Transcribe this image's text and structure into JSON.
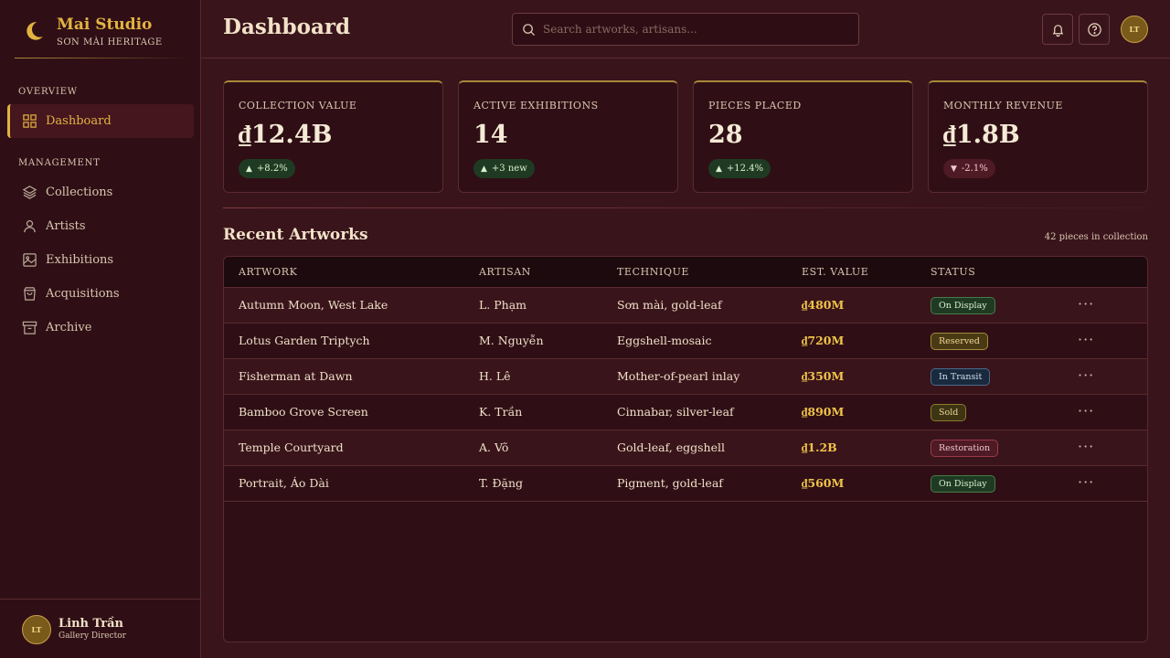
{
  "brand": {
    "title": "Mai Studio",
    "subtitle": "SƠN MÀI HERITAGE"
  },
  "sidebar": {
    "overview_label": "OVERVIEW",
    "management_label": "MANAGEMENT",
    "items": [
      {
        "label": "Dashboard",
        "icon": "grid-icon",
        "active": true
      },
      {
        "label": "Collections",
        "icon": "layers-icon"
      },
      {
        "label": "Artists",
        "icon": "user-icon"
      },
      {
        "label": "Exhibitions",
        "icon": "image-icon"
      },
      {
        "label": "Acquisitions",
        "icon": "bag-icon"
      },
      {
        "label": "Archive",
        "icon": "archive-icon"
      }
    ],
    "user": {
      "initials": "LT",
      "name": "Linh Trần",
      "role": "Gallery Director"
    }
  },
  "header": {
    "title": "Dashboard",
    "search_placeholder": "Search artworks, artisans...",
    "avatar_initials": "LT"
  },
  "stats": [
    {
      "label": "COLLECTION VALUE",
      "value": "₫12.4B",
      "change": "+8.2%",
      "trend": "up"
    },
    {
      "label": "ACTIVE EXHIBITIONS",
      "value": "14",
      "change": "+3 new",
      "trend": "up"
    },
    {
      "label": "PIECES PLACED",
      "value": "28",
      "change": "+12.4%",
      "trend": "up"
    },
    {
      "label": "MONTHLY REVENUE",
      "value": "₫1.8B",
      "change": "-2.1%",
      "trend": "down"
    }
  ],
  "recent": {
    "title": "Recent Artworks",
    "count_text": "42 pieces in collection",
    "columns": [
      "ARTWORK",
      "ARTISAN",
      "TECHNIQUE",
      "EST. VALUE",
      "STATUS"
    ],
    "rows": [
      {
        "artwork": "Autumn Moon, West Lake",
        "artisan": "L. Phạm",
        "technique": "Sơn mài, gold-leaf",
        "value": "₫480M",
        "status": "On Display"
      },
      {
        "artwork": "Lotus Garden Triptych",
        "artisan": "M. Nguyễn",
        "technique": "Eggshell-mosaic",
        "value": "₫720M",
        "status": "Reserved"
      },
      {
        "artwork": "Fisherman at Dawn",
        "artisan": "H. Lê",
        "technique": "Mother-of-pearl inlay",
        "value": "₫350M",
        "status": "In Transit"
      },
      {
        "artwork": "Bamboo Grove Screen",
        "artisan": "K. Trần",
        "technique": "Cinnabar, silver-leaf",
        "value": "₫890M",
        "status": "Sold"
      },
      {
        "artwork": "Temple Courtyard",
        "artisan": "A. Võ",
        "technique": "Gold-leaf, eggshell",
        "value": "₫1.2B",
        "status": "Restoration"
      },
      {
        "artwork": "Portrait, Áo Dài",
        "artisan": "T. Đặng",
        "technique": "Pigment, gold-leaf",
        "value": "₫560M",
        "status": "On Display"
      }
    ],
    "more_glyph": "···"
  },
  "colors": {
    "accent": "#e3b341",
    "background": "#3a141b",
    "sidebar": "#2f0f15"
  }
}
